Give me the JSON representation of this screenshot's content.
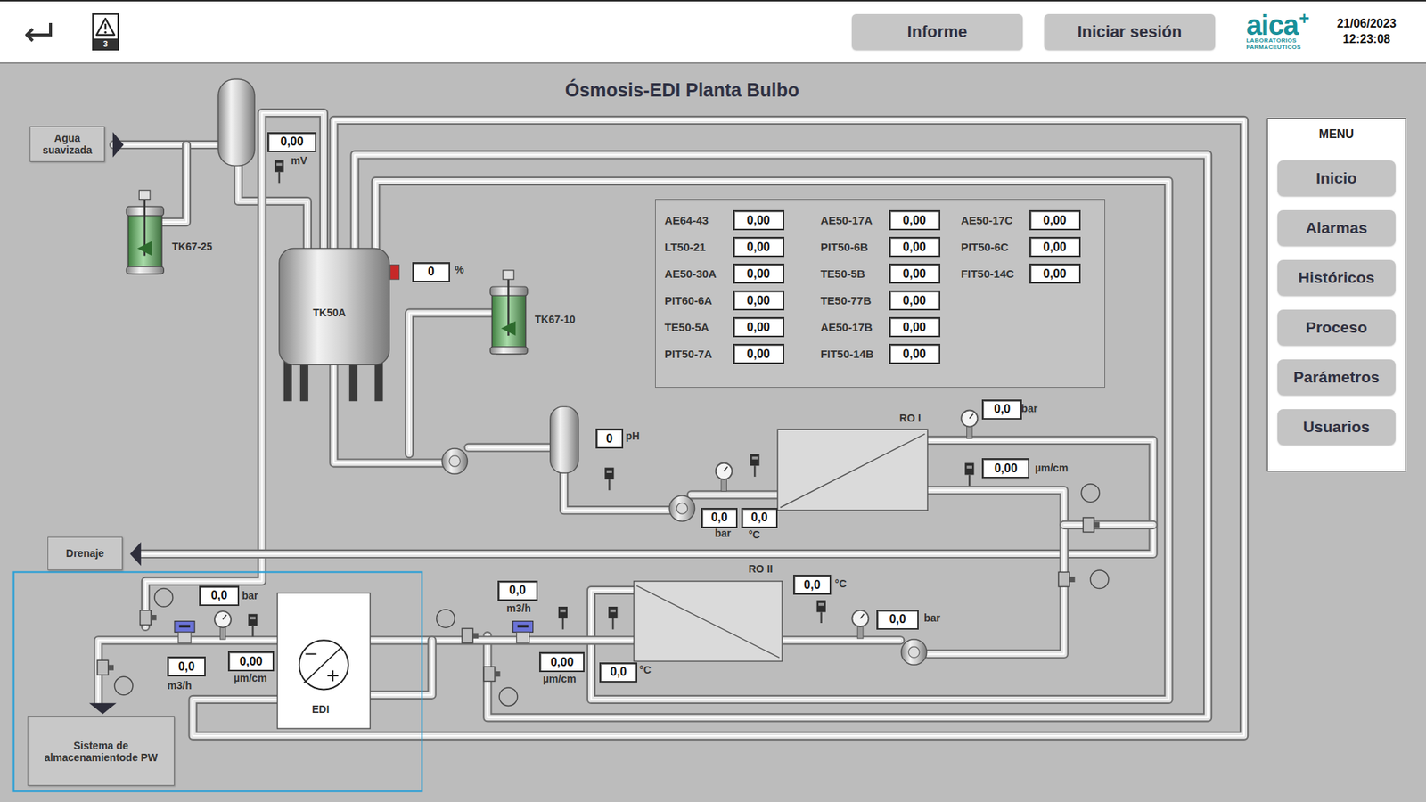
{
  "header": {
    "alarm_count": "3",
    "buttons": [
      "Informe",
      "Iniciar sesión"
    ],
    "logo": {
      "name": "aica",
      "mark": "+",
      "subtitle": [
        "LABORATORIOS",
        "FARMACEUTICOS"
      ]
    },
    "date": "21/06/2023",
    "time": "12:23:08"
  },
  "title": "Ósmosis-EDI Planta Bulbo",
  "menu": {
    "title": "MENU",
    "items": [
      "Inicio",
      "Alarmas",
      "Históricos",
      "Proceso",
      "Parámetros",
      "Usuarios"
    ]
  },
  "tag_panel": {
    "columns": [
      [
        {
          "tag": "AE64-43",
          "value": "0,00"
        },
        {
          "tag": "LT50-21",
          "value": "0,00"
        },
        {
          "tag": "AE50-30A",
          "value": "0,00"
        },
        {
          "tag": "PIT60-6A",
          "value": "0,00"
        },
        {
          "tag": "TE50-5A",
          "value": "0,00"
        },
        {
          "tag": "PIT50-7A",
          "value": "0,00"
        }
      ],
      [
        {
          "tag": "AE50-17A",
          "value": "0,00"
        },
        {
          "tag": "PIT50-6B",
          "value": "0,00"
        },
        {
          "tag": "TE50-5B",
          "value": "0,00"
        },
        {
          "tag": "TE50-77B",
          "value": "0,00"
        },
        {
          "tag": "AE50-17B",
          "value": "0,00"
        },
        {
          "tag": "FIT50-14B",
          "value": "0,00"
        }
      ],
      [
        {
          "tag": "AE50-17C",
          "value": "0,00"
        },
        {
          "tag": "PIT50-6C",
          "value": "0,00"
        },
        {
          "tag": "FIT50-14C",
          "value": "0,00"
        }
      ]
    ]
  },
  "diagram": {
    "terminals": [
      "Agua suavizada",
      "Drenaje",
      "Sistema de almacenamientode PW"
    ],
    "equipment": [
      "TK67-25",
      "TK50A",
      "TK67-10",
      "RO I",
      "RO II",
      "EDI"
    ],
    "readings": [
      {
        "value": "0,00",
        "unit": "mV"
      },
      {
        "value": "0",
        "unit": "%"
      },
      {
        "value": "0",
        "unit": "pH"
      },
      {
        "value": "0,0",
        "unit": "bar"
      },
      {
        "value": "0,0",
        "unit": "°C"
      },
      {
        "value": "0,0",
        "unit": "bar"
      },
      {
        "value": "0,00",
        "unit": "µm/cm"
      },
      {
        "value": "0,0",
        "unit": "°C"
      },
      {
        "value": "0,0",
        "unit": "bar"
      },
      {
        "value": "0,0",
        "unit": "°C"
      },
      {
        "value": "0,0",
        "unit": "m3/h"
      },
      {
        "value": "0,00",
        "unit": "µm/cm"
      },
      {
        "value": "0,0",
        "unit": "bar"
      },
      {
        "value": "0,0",
        "unit": "m3/h"
      },
      {
        "value": "0,00",
        "unit": "µm/cm"
      }
    ]
  }
}
